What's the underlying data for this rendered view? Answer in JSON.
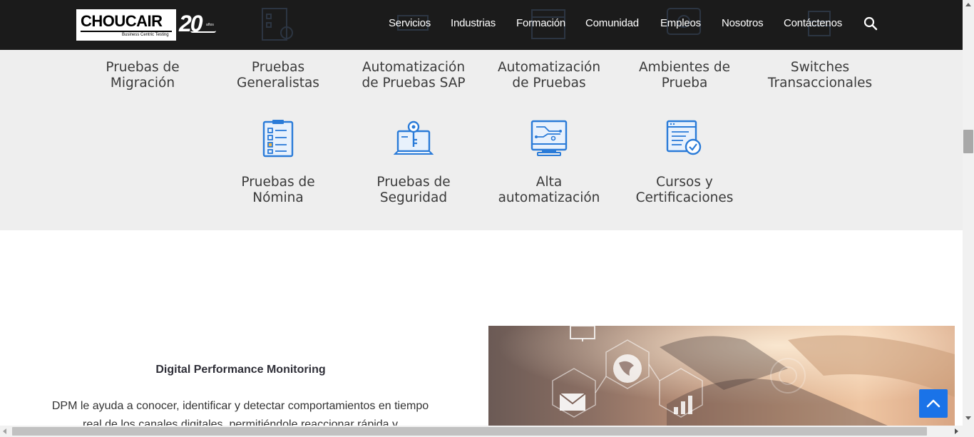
{
  "header": {
    "logo": {
      "wordmark": "CHOUCAIR",
      "tagline": "Business Centric Testing",
      "anniversary": "20",
      "anniversary_sub": "años"
    },
    "nav": [
      {
        "label": "Servicios"
      },
      {
        "label": "Industrias"
      },
      {
        "label": "Formación"
      },
      {
        "label": "Comunidad"
      },
      {
        "label": "Empleos"
      },
      {
        "label": "Nosotros"
      },
      {
        "label": "Contáctenos"
      }
    ],
    "search_icon": "search-icon"
  },
  "services": {
    "row1": [
      {
        "line1": "Pruebas de",
        "line2": "Migración"
      },
      {
        "line1": "Pruebas",
        "line2": "Generalistas"
      },
      {
        "line1": "Automatización",
        "line2": "de Pruebas SAP"
      },
      {
        "line1": "Automatización",
        "line2": "de Pruebas"
      },
      {
        "line1": "Ambientes de",
        "line2": "Prueba"
      },
      {
        "line1": "Switches",
        "line2": "Transaccionales"
      }
    ],
    "row2": [
      {
        "line1": "Pruebas de",
        "line2": "Nómina",
        "icon": "checklist-clipboard-icon"
      },
      {
        "line1": "Pruebas de",
        "line2": "Seguridad",
        "icon": "laptop-key-icon"
      },
      {
        "line1": "Alta",
        "line2": "automatización",
        "icon": "circuit-monitor-icon"
      },
      {
        "line1": "Cursos y",
        "line2": "Certificaciones",
        "icon": "certificate-check-icon"
      }
    ],
    "icon_color": "#2a7bd8"
  },
  "dpm": {
    "title": "Digital Performance Monitoring",
    "line1": "DPM le ayuda a conocer, identificar y detectar comportamientos en tiempo",
    "line2": "real de los canales digitales, permitiéndole reaccionar rápida y"
  },
  "colors": {
    "header_bg": "#1b1b1b",
    "section_bg": "#eeeeee",
    "accent": "#1a73e8"
  }
}
